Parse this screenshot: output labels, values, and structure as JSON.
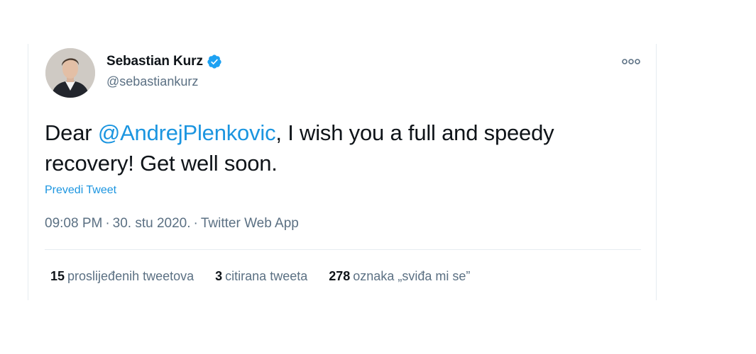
{
  "tweet": {
    "author": {
      "display_name": "Sebastian Kurz",
      "handle": "@sebastiankurz",
      "verified": true
    },
    "text_before": "Dear ",
    "mention": "@AndrejPlenkovic",
    "text_after": ", I wish you a full and speedy recovery! Get well soon.",
    "translate_label": "Prevedi Tweet",
    "time": "09:08 PM",
    "date": "30. stu 2020.",
    "source": "Twitter Web App",
    "separator": "·",
    "stats": [
      {
        "count": "15",
        "label": "proslijeđenih tweetova"
      },
      {
        "count": "3",
        "label": "citirana tweeta"
      },
      {
        "count": "278",
        "label": "oznaka „sviđa mi se”"
      }
    ]
  },
  "colors": {
    "link": "#1b95e0",
    "verified": "#1da1f2",
    "secondary_text": "#5b7083",
    "primary_text": "#0f1419",
    "border": "#e6ecf0"
  },
  "icons": {
    "verified": "verified-badge-icon",
    "more": "more-options-icon"
  }
}
